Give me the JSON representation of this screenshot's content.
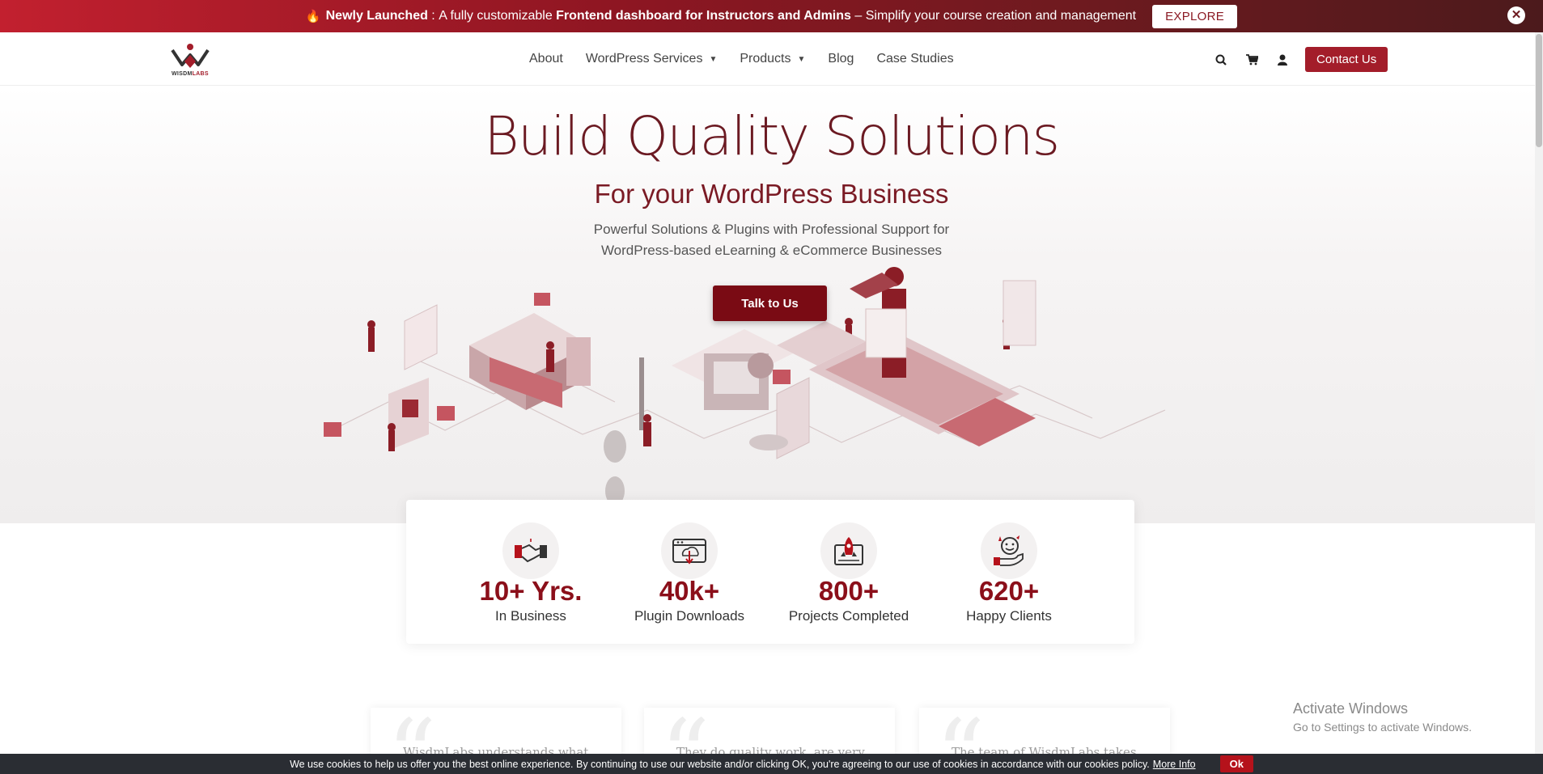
{
  "announcement": {
    "prefix": "Newly Launched",
    "colon": " : ",
    "text1": "A fully customizable ",
    "bold": "Frontend dashboard for Instructors and Admins",
    "text2": " – Simplify your course creation and management",
    "button": "EXPLORE",
    "close": "✕"
  },
  "logo": {
    "part1": "WISDM",
    "part2": "LABS"
  },
  "nav": {
    "items": [
      {
        "label": "About",
        "dropdown": false
      },
      {
        "label": "WordPress Services",
        "dropdown": true
      },
      {
        "label": "Products",
        "dropdown": true
      },
      {
        "label": "Blog",
        "dropdown": false
      },
      {
        "label": "Case Studies",
        "dropdown": false
      }
    ],
    "contact": "Contact Us"
  },
  "icons": [
    "search-icon",
    "cart-icon",
    "user-icon"
  ],
  "hero": {
    "title": "Build Quality Solutions",
    "subtitle": "For your WordPress Business",
    "description_line1": "Powerful Solutions & Plugins with Professional Support for",
    "description_line2": "WordPress-based eLearning & eCommerce Businesses",
    "cta": "Talk to Us"
  },
  "stats": [
    {
      "value": "10+ Yrs.",
      "label": "In Business",
      "icon": "handshake-icon"
    },
    {
      "value": "40k+",
      "label": "Plugin Downloads",
      "icon": "download-icon"
    },
    {
      "value": "800+",
      "label": "Projects Completed",
      "icon": "rocket-icon"
    },
    {
      "value": "620+",
      "label": "Happy Clients",
      "icon": "happy-client-icon"
    }
  ],
  "testimonials": [
    {
      "snippet": "WisdmLabs understands what"
    },
    {
      "snippet": "They do quality work, are very"
    },
    {
      "snippet": "The team of WisdmLabs takes"
    }
  ],
  "watermark": {
    "line1": "Activate Windows",
    "line2": "Go to Settings to activate Windows."
  },
  "cookie": {
    "text": "We use cookies to help us offer you the best online experience. By continuing to use our website and/or clicking OK, you're agreeing to our use of cookies in accordance with our cookies policy.",
    "more": "More Info",
    "ok": "Ok"
  },
  "colors": {
    "brand": "#a31d2a",
    "dark_brand": "#7a0b14",
    "stat_number": "#8b0f1a"
  }
}
